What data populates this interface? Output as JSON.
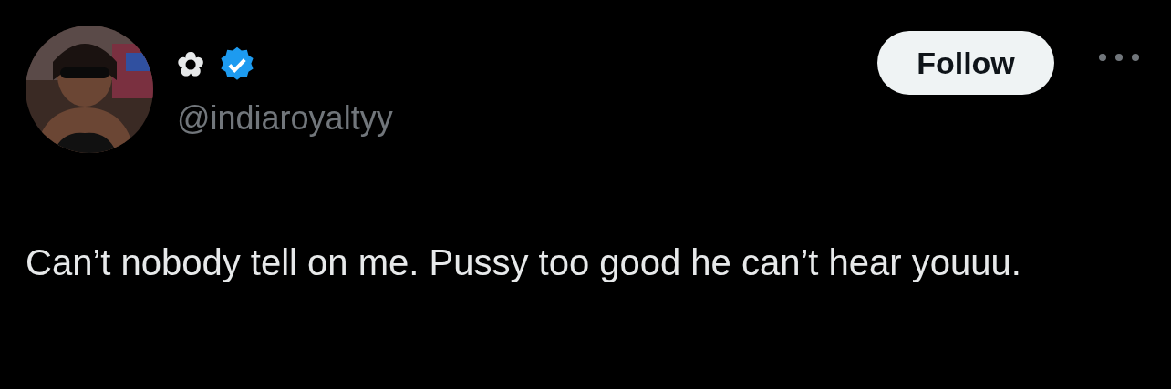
{
  "tweet": {
    "author": {
      "display_name": "✿",
      "verified": true,
      "handle": "@indiaroyaltyy"
    },
    "follow_button": {
      "label": "Follow"
    },
    "text": "Can’t nobody tell on me. Pussy too good he can’t hear youuu."
  }
}
